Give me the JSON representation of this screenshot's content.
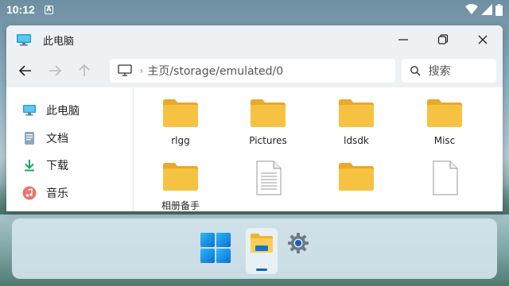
{
  "status_bar": {
    "time": "10:12",
    "app_badge": "A"
  },
  "window": {
    "title": "此电脑",
    "address_path": "主页/storage/emulated/0",
    "search_placeholder": "搜索"
  },
  "sidebar": {
    "items": [
      {
        "label": "此电脑",
        "icon": "monitor-icon"
      },
      {
        "label": "文档",
        "icon": "document-icon"
      },
      {
        "label": "下载",
        "icon": "download-icon"
      },
      {
        "label": "音乐",
        "icon": "music-icon"
      }
    ]
  },
  "files": [
    {
      "name": "rlgg",
      "type": "folder"
    },
    {
      "name": "Pictures",
      "type": "folder"
    },
    {
      "name": "ldsdk",
      "type": "folder"
    },
    {
      "name": "Misc",
      "type": "folder"
    },
    {
      "name": "相册备手",
      "type": "folder"
    },
    {
      "name": "",
      "type": "file"
    },
    {
      "name": "",
      "type": "folder"
    },
    {
      "name": "",
      "type": "file"
    }
  ],
  "taskbar": {
    "items": [
      {
        "name": "start-button",
        "icon": "windows-logo-icon",
        "active": false
      },
      {
        "name": "file-explorer-button",
        "icon": "file-explorer-icon",
        "active": true
      },
      {
        "name": "settings-button",
        "icon": "gear-icon",
        "active": false
      }
    ]
  },
  "colors": {
    "folder": "#f5c242",
    "accent": "#0067c0"
  }
}
